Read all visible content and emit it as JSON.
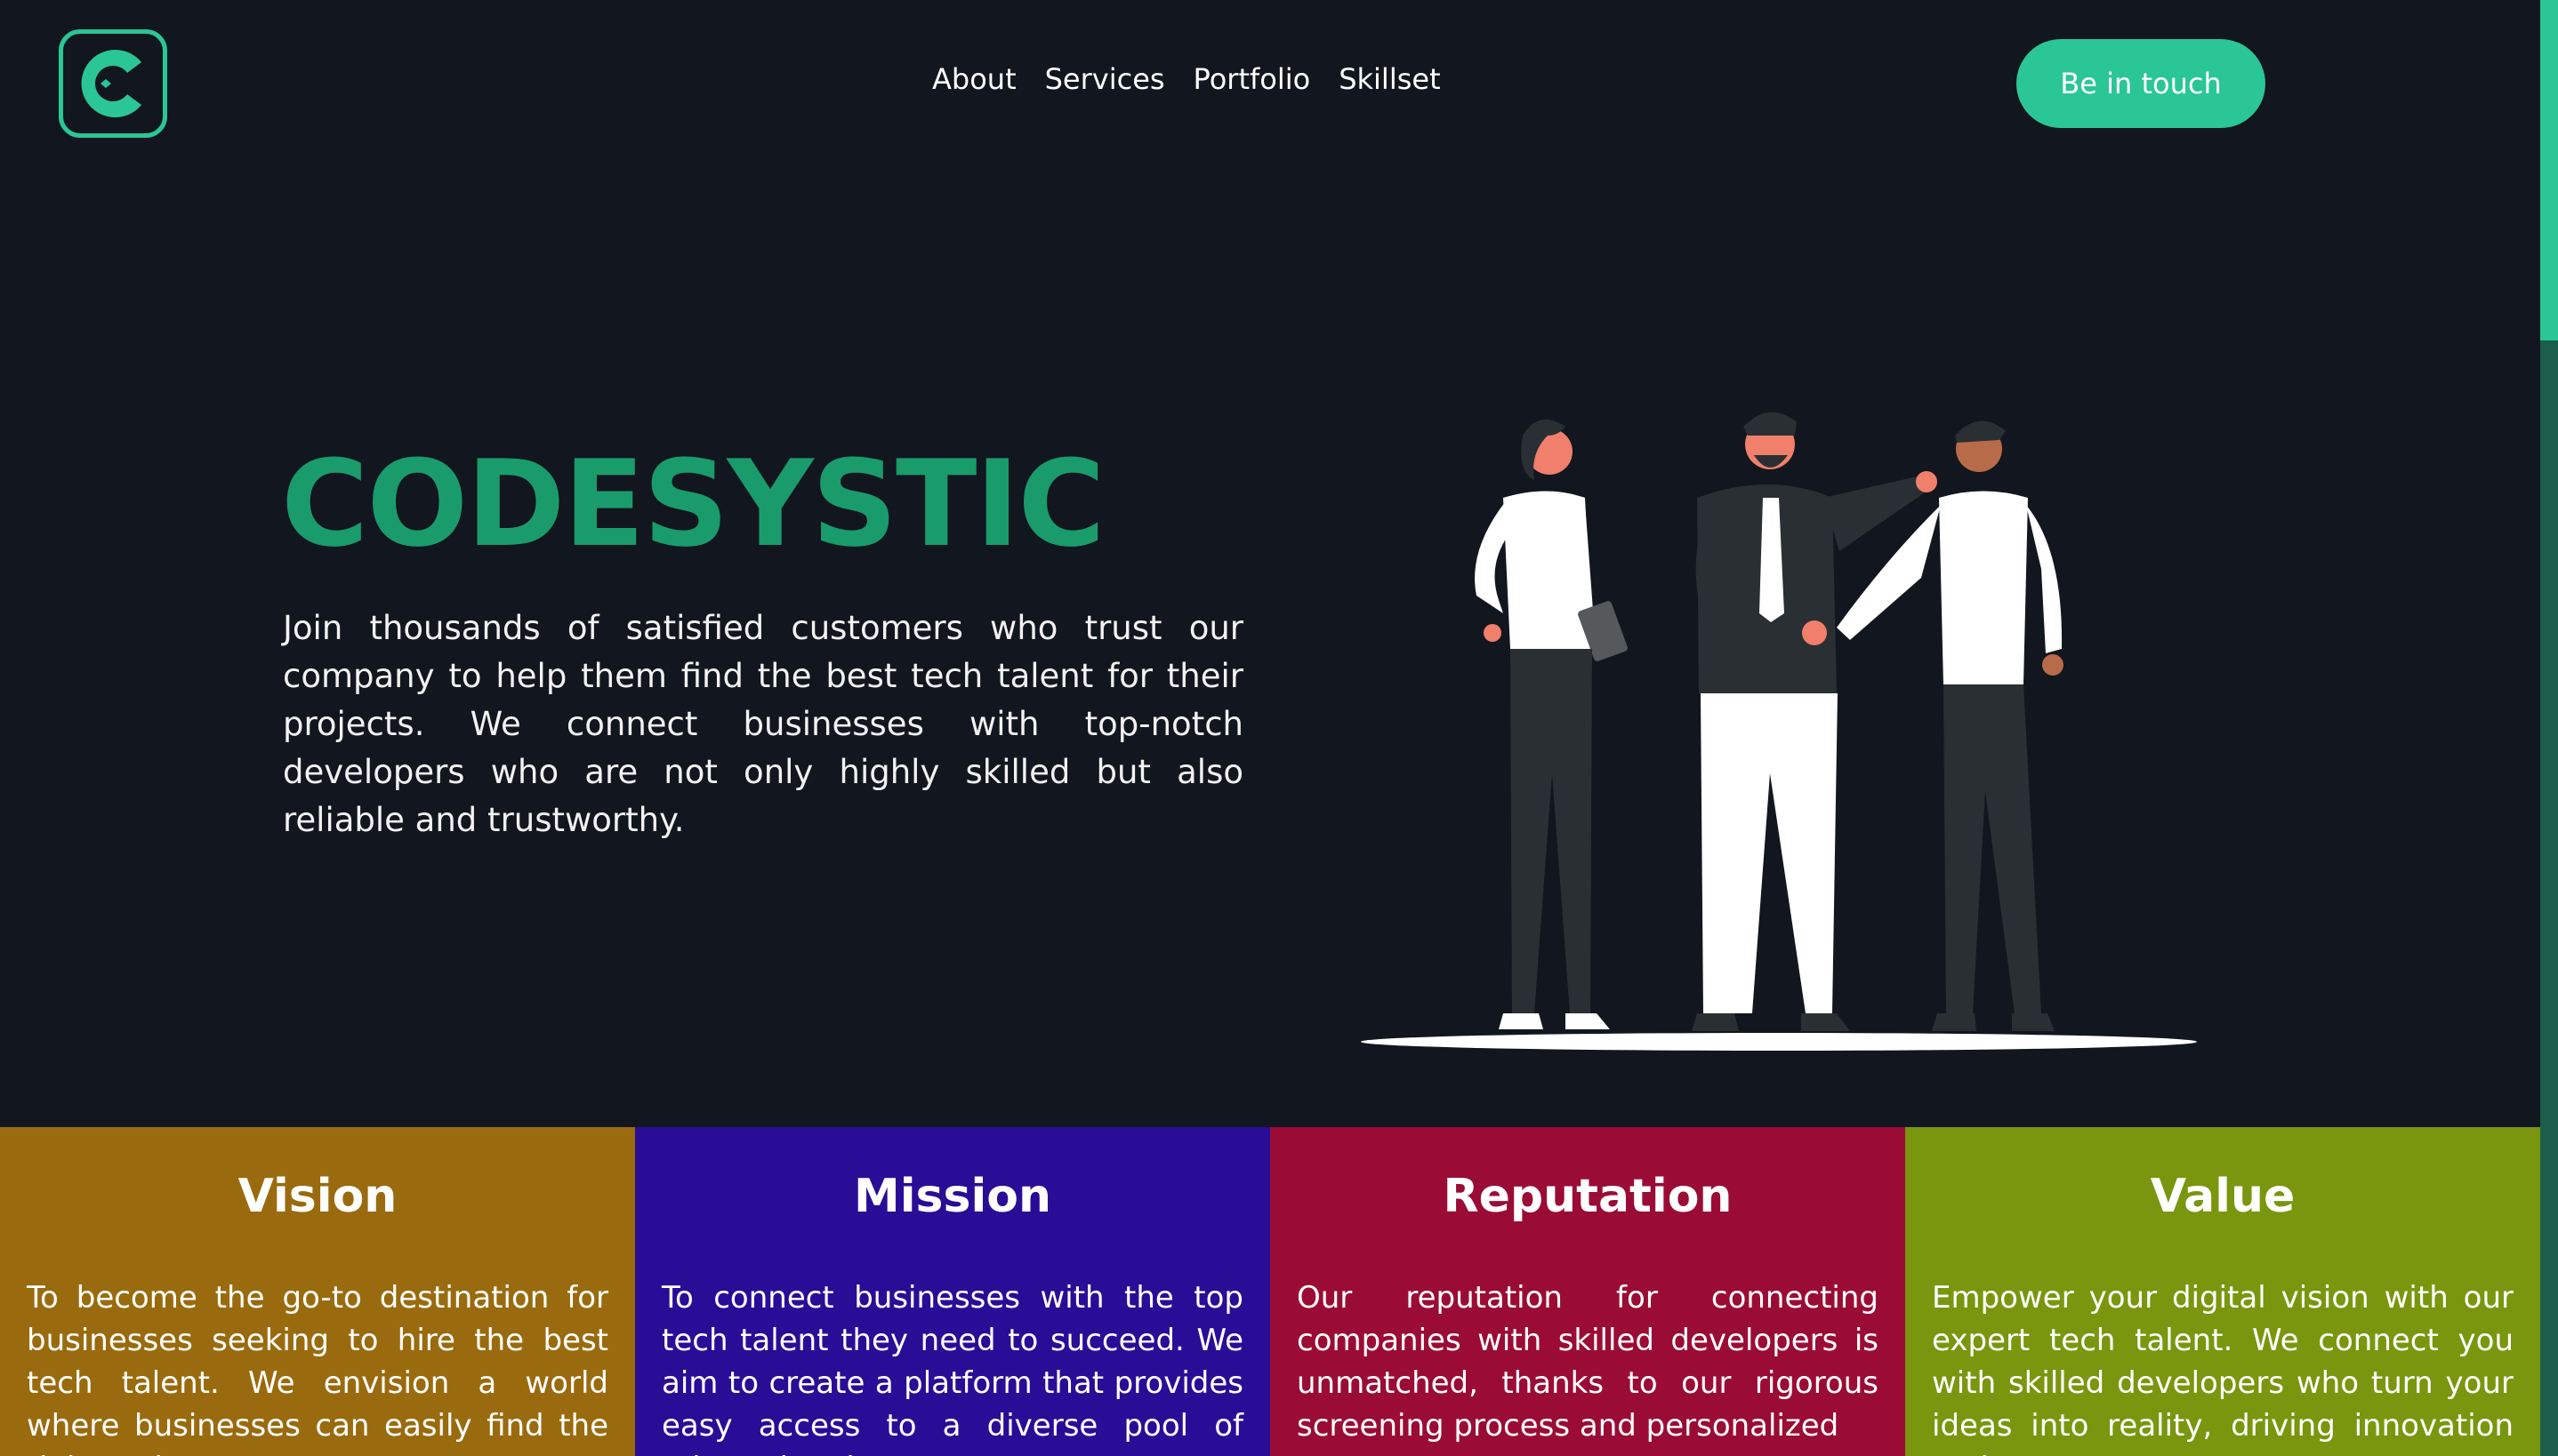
{
  "brand": {
    "logo_letter": "C",
    "accent": "#2bc695"
  },
  "nav": {
    "items": [
      "About",
      "Services",
      "Portfolio",
      "Skillset"
    ]
  },
  "cta": {
    "label": "Be in touch"
  },
  "hero": {
    "title": "CODESYSTIC",
    "text": "Join thousands of satisfied customers who trust our company to help them find the best tech talent for their projects. We connect businesses with top-notch developers who are not only highly skilled but also reliable and trustworthy."
  },
  "cards": [
    {
      "title": "Vision",
      "color": "#9a6b0e",
      "text": "To become the go-to destination for businesses seeking to hire the best tech talent. We envision a world where businesses can easily find the right tech"
    },
    {
      "title": "Mission",
      "color": "#2a0d96",
      "text": "To connect businesses with the top tech talent they need to succeed. We aim to create a platform that provides easy access to a diverse pool of talented and"
    },
    {
      "title": "Reputation",
      "color": "#9a0c36",
      "text": "Our reputation for connecting companies with skilled developers is unmatched, thanks to our rigorous screening process and personalized"
    },
    {
      "title": "Value",
      "color": "#7a960f",
      "text": "Empower your digital vision with our expert tech talent. We connect you with skilled developers who turn your ideas into reality, driving innovation and"
    }
  ]
}
